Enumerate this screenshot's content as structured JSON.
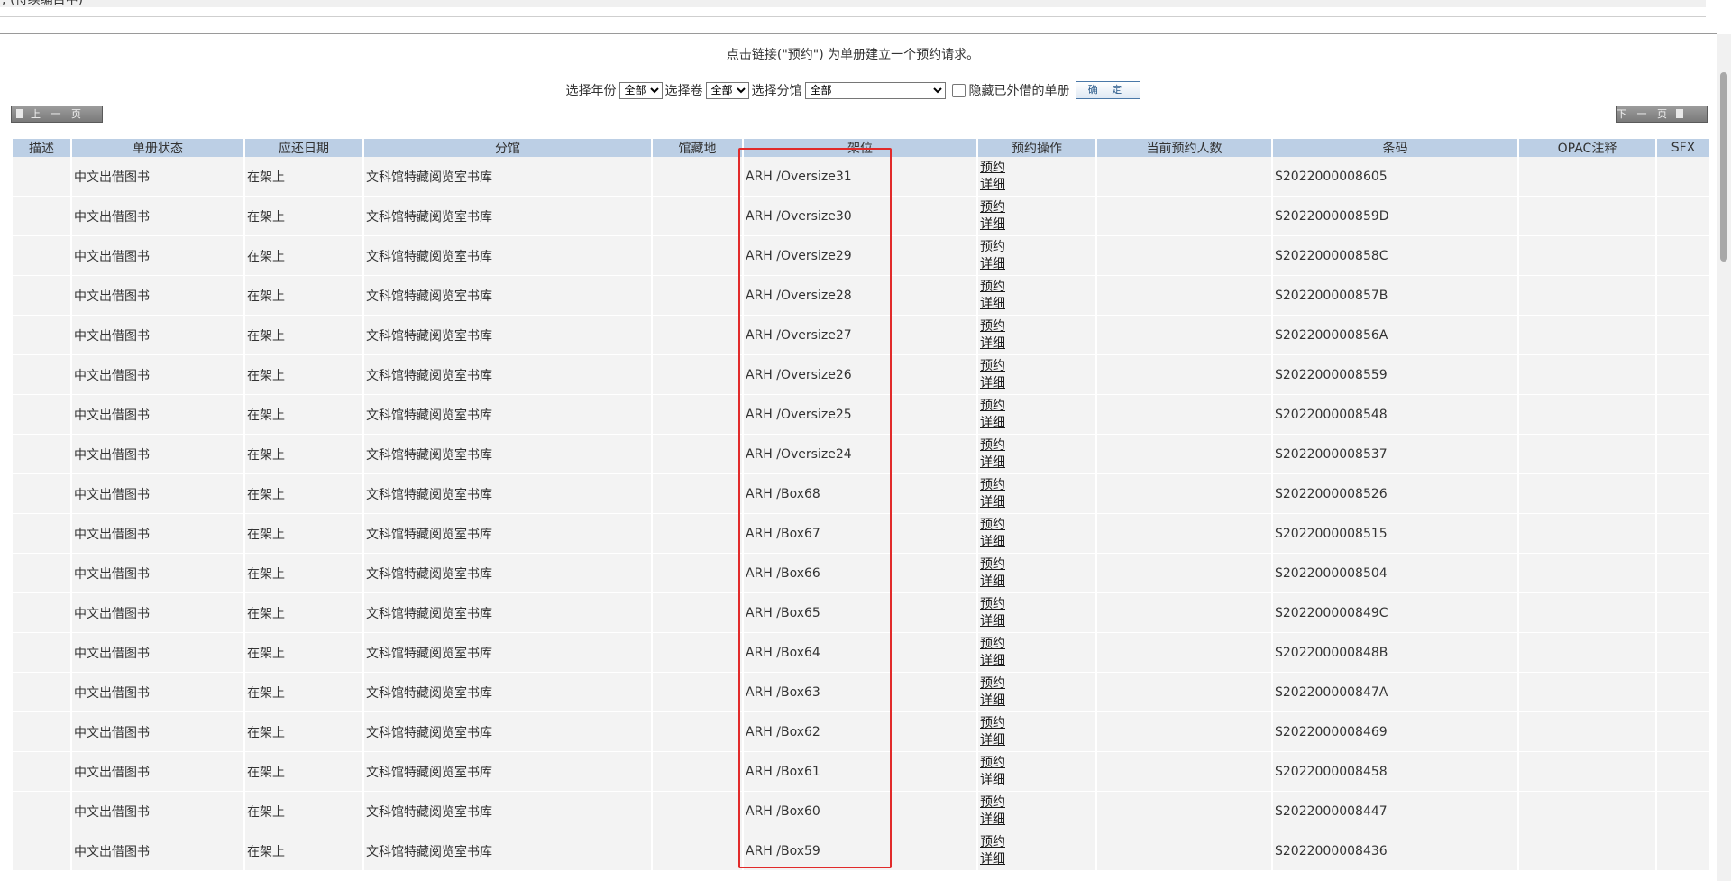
{
  "header": {
    "truncated_text": "; (待续编目中)"
  },
  "hint": "点击链接(\"预约\") 为单册建立一个预约请求。",
  "filters": {
    "year_label": "选择年份",
    "year_value": "全部",
    "volume_label": "选择卷",
    "volume_value": "全部",
    "sublibrary_label": "选择分馆",
    "sublibrary_value": "全部",
    "hide_loaned_label": "隐藏已外借的单册",
    "confirm_label": "确 定"
  },
  "pager": {
    "prev_label": "上 一 页",
    "next_label": "下 一 页"
  },
  "table": {
    "columns": [
      "描述",
      "单册状态",
      "应还日期",
      "分馆",
      "馆藏地",
      "架位",
      "预约操作",
      "当前预约人数",
      "条码",
      "OPAC注释",
      "SFX"
    ],
    "actions": {
      "reserve": "预约",
      "details": "详细"
    },
    "rows": [
      {
        "status": "中文出借图书",
        "due": "在架上",
        "sublibrary": "文科馆特藏阅览室书库",
        "location": "ARH /Oversize31",
        "barcode": "S2022000008605"
      },
      {
        "status": "中文出借图书",
        "due": "在架上",
        "sublibrary": "文科馆特藏阅览室书库",
        "location": "ARH /Oversize30",
        "barcode": "S202200000859D"
      },
      {
        "status": "中文出借图书",
        "due": "在架上",
        "sublibrary": "文科馆特藏阅览室书库",
        "location": "ARH /Oversize29",
        "barcode": "S202200000858C"
      },
      {
        "status": "中文出借图书",
        "due": "在架上",
        "sublibrary": "文科馆特藏阅览室书库",
        "location": "ARH /Oversize28",
        "barcode": "S202200000857B"
      },
      {
        "status": "中文出借图书",
        "due": "在架上",
        "sublibrary": "文科馆特藏阅览室书库",
        "location": "ARH /Oversize27",
        "barcode": "S202200000856A"
      },
      {
        "status": "中文出借图书",
        "due": "在架上",
        "sublibrary": "文科馆特藏阅览室书库",
        "location": "ARH /Oversize26",
        "barcode": "S2022000008559"
      },
      {
        "status": "中文出借图书",
        "due": "在架上",
        "sublibrary": "文科馆特藏阅览室书库",
        "location": "ARH /Oversize25",
        "barcode": "S2022000008548"
      },
      {
        "status": "中文出借图书",
        "due": "在架上",
        "sublibrary": "文科馆特藏阅览室书库",
        "location": "ARH /Oversize24",
        "barcode": "S2022000008537"
      },
      {
        "status": "中文出借图书",
        "due": "在架上",
        "sublibrary": "文科馆特藏阅览室书库",
        "location": "ARH /Box68",
        "barcode": "S2022000008526"
      },
      {
        "status": "中文出借图书",
        "due": "在架上",
        "sublibrary": "文科馆特藏阅览室书库",
        "location": "ARH /Box67",
        "barcode": "S2022000008515"
      },
      {
        "status": "中文出借图书",
        "due": "在架上",
        "sublibrary": "文科馆特藏阅览室书库",
        "location": "ARH /Box66",
        "barcode": "S2022000008504"
      },
      {
        "status": "中文出借图书",
        "due": "在架上",
        "sublibrary": "文科馆特藏阅览室书库",
        "location": "ARH /Box65",
        "barcode": "S202200000849C"
      },
      {
        "status": "中文出借图书",
        "due": "在架上",
        "sublibrary": "文科馆特藏阅览室书库",
        "location": "ARH /Box64",
        "barcode": "S202200000848B"
      },
      {
        "status": "中文出借图书",
        "due": "在架上",
        "sublibrary": "文科馆特藏阅览室书库",
        "location": "ARH /Box63",
        "barcode": "S202200000847A"
      },
      {
        "status": "中文出借图书",
        "due": "在架上",
        "sublibrary": "文科馆特藏阅览室书库",
        "location": "ARH /Box62",
        "barcode": "S2022000008469"
      },
      {
        "status": "中文出借图书",
        "due": "在架上",
        "sublibrary": "文科馆特藏阅览室书库",
        "location": "ARH /Box61",
        "barcode": "S2022000008458"
      },
      {
        "status": "中文出借图书",
        "due": "在架上",
        "sublibrary": "文科馆特藏阅览室书库",
        "location": "ARH /Box60",
        "barcode": "S2022000008447"
      },
      {
        "status": "中文出借图书",
        "due": "在架上",
        "sublibrary": "文科馆特藏阅览室书库",
        "location": "ARH /Box59",
        "barcode": "S2022000008436"
      }
    ]
  },
  "annotation": {
    "color": "#e12a2a",
    "target": "架位"
  }
}
